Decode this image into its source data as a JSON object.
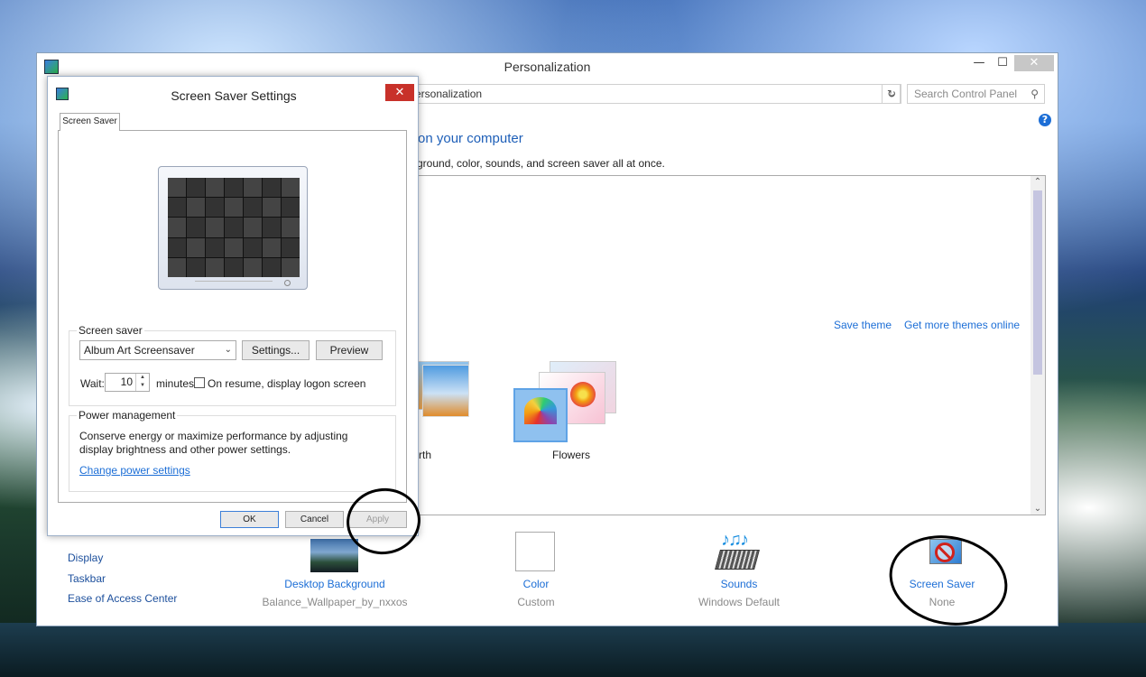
{
  "main_window": {
    "title": "Personalization",
    "buttons": {
      "minimize": "—",
      "maximize": "☐",
      "close": "✕"
    },
    "address": "ersonalization",
    "search_placeholder": "Search Control Panel",
    "heading": "on your computer",
    "subheading": "kground, color, sounds, and screen saver all at once.",
    "links": {
      "save_theme": "Save theme",
      "get_more": "Get more themes online"
    },
    "themes": [
      {
        "label": "rth"
      },
      {
        "label": "Flowers"
      }
    ],
    "see_also": [
      "Display",
      "Taskbar",
      "Ease of Access Center"
    ],
    "bottom_items": [
      {
        "title": "Desktop Background",
        "sub": "Balance_Wallpaper_by_nxxos"
      },
      {
        "title": "Color",
        "sub": "Custom"
      },
      {
        "title": "Sounds",
        "sub": "Windows Default"
      },
      {
        "title": "Screen Saver",
        "sub": "None"
      }
    ]
  },
  "dialog": {
    "title": "Screen Saver Settings",
    "close": "✕",
    "tab": "Screen Saver",
    "screen_saver_group": "Screen saver",
    "selected_saver": "Album Art Screensaver",
    "settings_button": "Settings...",
    "preview_button": "Preview",
    "wait_label": "Wait:",
    "wait_value": "10",
    "minutes_label": "minutes",
    "resume_label": "On resume, display logon screen",
    "resume_checked": false,
    "power_group": "Power management",
    "power_desc": "Conserve energy or maximize performance by adjusting display brightness and other power settings.",
    "power_link": "Change power settings",
    "ok": "OK",
    "cancel": "Cancel",
    "apply": "Apply"
  },
  "icons": {
    "refresh": "↻",
    "search": "⚲",
    "help": "?",
    "chevron": "⌄"
  }
}
